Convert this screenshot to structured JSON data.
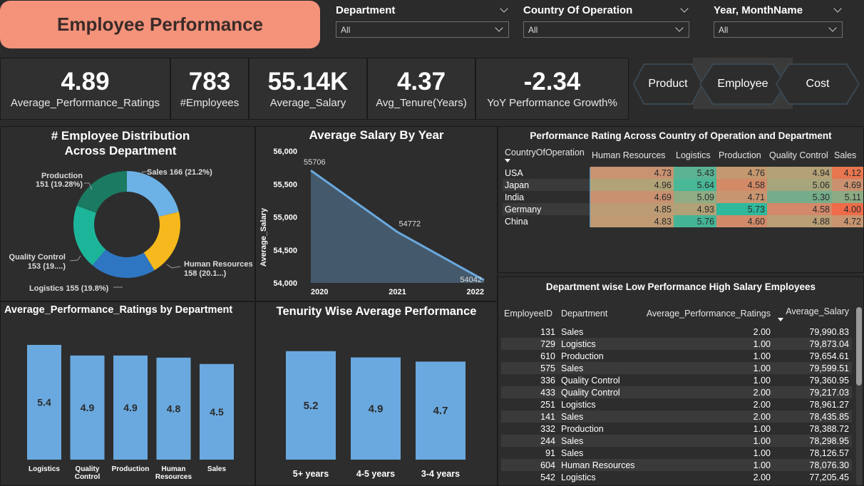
{
  "header": {
    "title": "Employee Performance"
  },
  "slicers": [
    {
      "label": "Department",
      "value": "All"
    },
    {
      "label": "Country Of Operation",
      "value": "All"
    },
    {
      "label": "Year, MonthName",
      "value": "All"
    }
  ],
  "kpis": [
    {
      "value": "4.89",
      "label": "Average_Performance_Ratings"
    },
    {
      "value": "783",
      "label": "#Employees"
    },
    {
      "value": "55.14K",
      "label": "Average_Salary"
    },
    {
      "value": "4.37",
      "label": "Avg_Tenure(Years)"
    },
    {
      "value": "-2.34",
      "label": "YoY Performance Growth%"
    }
  ],
  "nav": {
    "product": "Product",
    "employee": "Employee",
    "cost": "Cost"
  },
  "donut": {
    "title": "# Employee Distribution Across Department",
    "labels": {
      "sales": "Sales 166 (21.2%)",
      "hr_1": "Human Resources",
      "hr_2": "158 (20.1...)",
      "logistics": "Logistics 155 (19.8%)",
      "qc_1": "Quality Control",
      "qc_2": "153 (19....)",
      "prod_1": "Production",
      "prod_2": "151 (19.28%)"
    },
    "colors": [
      "#6cb2e6",
      "#f6b81c",
      "#2f76c2",
      "#1db59a",
      "#1a7a62"
    ]
  },
  "salary_chart": {
    "title": "Average Salary By Year",
    "ylabel": "Average_Salary",
    "yticks": [
      "56,000",
      "55,500",
      "55,000",
      "54,500",
      "54,000"
    ],
    "xticks": [
      "2020",
      "2021",
      "2022"
    ],
    "point_labels": [
      "55706",
      "54772",
      "54042"
    ]
  },
  "perf_dept": {
    "title": "Average_Performance_Ratings by Department",
    "cats": [
      {
        "l1": "Logistics",
        "l2": ""
      },
      {
        "l1": "Quality",
        "l2": "Control"
      },
      {
        "l1": "Production",
        "l2": ""
      },
      {
        "l1": "Human",
        "l2": "Resources"
      },
      {
        "l1": "Sales",
        "l2": ""
      }
    ],
    "value_labels": [
      "5.4",
      "4.9",
      "4.9",
      "4.8",
      "4.5"
    ]
  },
  "tenure": {
    "title": "Tenurity Wise Average Performance",
    "cats": [
      "5+ years",
      "4-5 years",
      "3-4 years"
    ],
    "value_labels": [
      "5.2",
      "4.9",
      "4.7"
    ]
  },
  "matrix": {
    "title": "Performance Rating Across Country of Operation and Department",
    "headers": [
      "CountryOfOperation",
      "Human Resources",
      "Logistics",
      "Production",
      "Quality Control",
      "Sales"
    ],
    "rows": [
      {
        "country": "USA",
        "vals": [
          "4.73",
          "5.43",
          "4.76",
          "4.94",
          "4.12"
        ],
        "colors": [
          "#c99270",
          "#5bb393",
          "#c4996f",
          "#b5a177",
          "#e8764f"
        ]
      },
      {
        "country": "Japan",
        "vals": [
          "4.96",
          "5.64",
          "4.58",
          "5.06",
          "4.69"
        ],
        "colors": [
          "#b1a377",
          "#48b897",
          "#d28a67",
          "#a6a57b",
          "#ca9170"
        ]
      },
      {
        "country": "India",
        "vals": [
          "4.69",
          "5.09",
          "4.71",
          "5.30",
          "5.11"
        ],
        "colors": [
          "#c99170",
          "#8fac84",
          "#c89571",
          "#75ad8a",
          "#8dab84"
        ]
      },
      {
        "country": "Germany",
        "vals": [
          "4.85",
          "4.93",
          "5.73",
          "4.58",
          "4.00"
        ],
        "colors": [
          "#bb9c74",
          "#b1a177",
          "#2fb89b",
          "#d3896a",
          "#ef6b49"
        ]
      },
      {
        "country": "China",
        "vals": [
          "4.83",
          "5.76",
          "4.60",
          "4.88",
          "4.72"
        ],
        "colors": [
          "#bf9a73",
          "#45b496",
          "#d18a69",
          "#b99e76",
          "#c89470"
        ]
      }
    ]
  },
  "low_perf": {
    "title": "Department wise Low Performance High Salary Employees",
    "headers": [
      "EmployeeID",
      "Department",
      "Average_Performance_Ratings",
      "Average_Salary"
    ],
    "rows": [
      [
        "131",
        "Sales",
        "2.00",
        "79,990.83"
      ],
      [
        "729",
        "Logistics",
        "1.00",
        "79,873.04"
      ],
      [
        "610",
        "Production",
        "1.00",
        "79,654.61"
      ],
      [
        "575",
        "Sales",
        "1.00",
        "79,599.51"
      ],
      [
        "336",
        "Quality Control",
        "1.00",
        "79,360.95"
      ],
      [
        "433",
        "Quality Control",
        "2.00",
        "79,217.03"
      ],
      [
        "251",
        "Logistics",
        "2.00",
        "78,961.27"
      ],
      [
        "141",
        "Sales",
        "2.00",
        "78,435.85"
      ],
      [
        "332",
        "Production",
        "1.00",
        "78,388.72"
      ],
      [
        "244",
        "Sales",
        "1.00",
        "78,298.95"
      ],
      [
        "91",
        "Sales",
        "1.00",
        "78,126.57"
      ],
      [
        "604",
        "Human Resources",
        "1.00",
        "78,076.30"
      ],
      [
        "542",
        "Logistics",
        "2.00",
        "77,205.45"
      ]
    ]
  },
  "chart_data": [
    {
      "type": "pie",
      "title": "# Employee Distribution Across Department",
      "categories": [
        "Sales",
        "Human Resources",
        "Logistics",
        "Quality Control",
        "Production"
      ],
      "values": [
        166,
        158,
        155,
        153,
        151
      ]
    },
    {
      "type": "area",
      "title": "Average Salary By Year",
      "x": [
        2020,
        2021,
        2022
      ],
      "values": [
        55706,
        54772,
        54042
      ],
      "ylabel": "Average_Salary",
      "ylim": [
        54000,
        56000
      ]
    },
    {
      "type": "bar",
      "title": "Average_Performance_Ratings by Department",
      "categories": [
        "Logistics",
        "Quality Control",
        "Production",
        "Human Resources",
        "Sales"
      ],
      "values": [
        5.4,
        4.9,
        4.9,
        4.8,
        4.5
      ],
      "ylim": [
        0,
        5.5
      ]
    },
    {
      "type": "bar",
      "title": "Tenurity Wise Average Performance",
      "categories": [
        "5+ years",
        "4-5 years",
        "3-4 years"
      ],
      "values": [
        5.2,
        4.9,
        4.7
      ],
      "ylim": [
        0,
        5.5
      ]
    }
  ]
}
